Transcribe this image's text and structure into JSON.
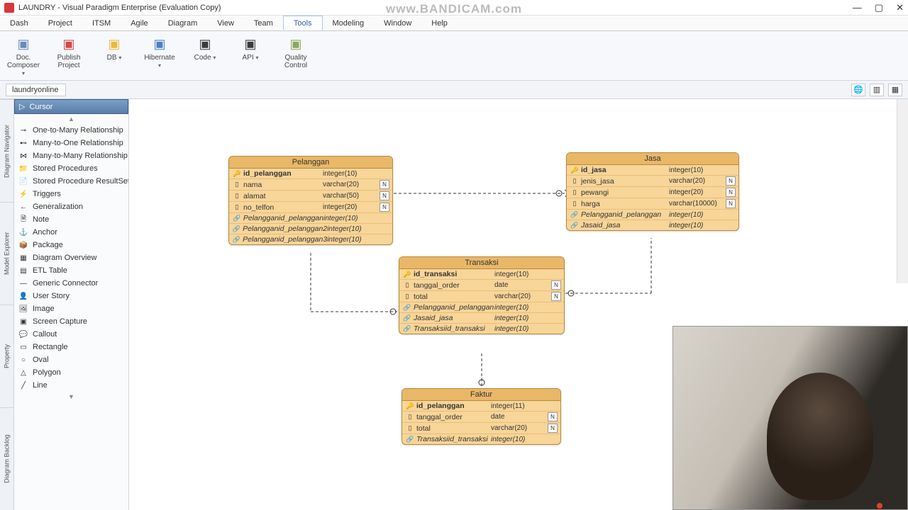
{
  "window": {
    "title": "LAUNDRY - Visual Paradigm Enterprise (Evaluation Copy)",
    "watermark": "www.BANDICAM.com"
  },
  "menu": [
    "Dash",
    "Project",
    "ITSM",
    "Agile",
    "Diagram",
    "View",
    "Team",
    "Tools",
    "Modeling",
    "Window",
    "Help"
  ],
  "menu_active": "Tools",
  "ribbon": [
    {
      "label": "Doc. Composer",
      "dropdown": true,
      "color": "#6a8bb8"
    },
    {
      "label": "Publish Project",
      "dropdown": false,
      "color": "#d24a4a"
    },
    {
      "label": "DB",
      "dropdown": true,
      "color": "#e8b93a"
    },
    {
      "label": "Hibernate",
      "dropdown": true,
      "color": "#4a7fc4"
    },
    {
      "label": "Code",
      "dropdown": true,
      "color": "#3a3a3a"
    },
    {
      "label": "API",
      "dropdown": true,
      "color": "#3a3a3a"
    },
    {
      "label": "Quality Control",
      "dropdown": false,
      "color": "#8aa85a"
    }
  ],
  "breadcrumb": "laundryonline",
  "vertical_tabs": [
    "Diagram Navigator",
    "Model Explorer",
    "Property",
    "Diagram Backlog"
  ],
  "palette_cursor": "Cursor",
  "palette": [
    {
      "icon": "⊸",
      "label": "One-to-Many Relationship"
    },
    {
      "icon": "⊷",
      "label": "Many-to-One Relationship"
    },
    {
      "icon": "⋈",
      "label": "Many-to-Many Relationship"
    },
    {
      "icon": "📁",
      "label": "Stored Procedures"
    },
    {
      "icon": "📄",
      "label": "Stored Procedure ResultSet"
    },
    {
      "icon": "⚡",
      "label": "Triggers"
    },
    {
      "icon": "←",
      "label": "Generalization"
    },
    {
      "icon": "🗎",
      "label": "Note"
    },
    {
      "icon": "⚓",
      "label": "Anchor"
    },
    {
      "icon": "📦",
      "label": "Package"
    },
    {
      "icon": "▦",
      "label": "Diagram Overview"
    },
    {
      "icon": "▤",
      "label": "ETL Table"
    },
    {
      "icon": "—",
      "label": "Generic Connector"
    },
    {
      "icon": "👤",
      "label": "User Story"
    },
    {
      "icon": "🖼",
      "label": "Image"
    },
    {
      "icon": "▣",
      "label": "Screen Capture"
    },
    {
      "icon": "💬",
      "label": "Callout"
    },
    {
      "icon": "▭",
      "label": "Rectangle"
    },
    {
      "icon": "○",
      "label": "Oval"
    },
    {
      "icon": "△",
      "label": "Polygon"
    },
    {
      "icon": "╱",
      "label": "Line"
    }
  ],
  "tables": {
    "pelanggan": {
      "title": "Pelanggan",
      "cols": [
        {
          "icon": "🔑",
          "name": "id_pelanggan",
          "type": "integer(10)",
          "bold": true
        },
        {
          "icon": "▯",
          "name": "nama",
          "type": "varchar(20)",
          "n": true
        },
        {
          "icon": "▯",
          "name": "alamat",
          "type": "varchar(50)",
          "n": true
        },
        {
          "icon": "▯",
          "name": "no_telfon",
          "type": "integer(20)",
          "n": true
        },
        {
          "icon": "🔗",
          "name": "Pelangganid_pelanggan",
          "type": "integer(10)",
          "fk": true
        },
        {
          "icon": "🔗",
          "name": "Pelangganid_pelanggan2",
          "type": "integer(10)",
          "fk": true
        },
        {
          "icon": "🔗",
          "name": "Pelangganid_pelanggan3",
          "type": "integer(10)",
          "fk": true
        }
      ]
    },
    "jasa": {
      "title": "Jasa",
      "cols": [
        {
          "icon": "🔑",
          "name": "id_jasa",
          "type": "integer(10)",
          "bold": true
        },
        {
          "icon": "▯",
          "name": "jenis_jasa",
          "type": "varchar(20)",
          "n": true
        },
        {
          "icon": "▯",
          "name": "pewangi",
          "type": "integer(20)",
          "n": true
        },
        {
          "icon": "▯",
          "name": "harga",
          "type": "varchar(10000)",
          "n": true
        },
        {
          "icon": "🔗",
          "name": "Pelangganid_pelanggan",
          "type": "integer(10)",
          "fk": true
        },
        {
          "icon": "🔗",
          "name": "Jasaid_jasa",
          "type": "integer(10)",
          "fk": true
        }
      ]
    },
    "transaksi": {
      "title": "Transaksi",
      "cols": [
        {
          "icon": "🔑",
          "name": "id_transaksi",
          "type": "integer(10)",
          "bold": true
        },
        {
          "icon": "▯",
          "name": "tanggal_order",
          "type": "date",
          "n": true
        },
        {
          "icon": "▯",
          "name": "total",
          "type": "varchar(20)",
          "n": true
        },
        {
          "icon": "🔗",
          "name": "Pelangganid_pelanggan",
          "type": "integer(10)",
          "fk": true
        },
        {
          "icon": "🔗",
          "name": "Jasaid_jasa",
          "type": "integer(10)",
          "fk": true
        },
        {
          "icon": "🔗",
          "name": "Transaksiid_transaksi",
          "type": "integer(10)",
          "fk": true
        }
      ]
    },
    "faktur": {
      "title": "Faktur",
      "cols": [
        {
          "icon": "🔑",
          "name": "id_pelanggan",
          "type": "integer(11)",
          "bold": true
        },
        {
          "icon": "▯",
          "name": "tanggal_order",
          "type": "date",
          "n": true
        },
        {
          "icon": "▯",
          "name": "total",
          "type": "varchar(20)",
          "n": true
        },
        {
          "icon": "🔗",
          "name": "Transaksiid_transaksi",
          "type": "integer(10)",
          "fk": true
        }
      ]
    }
  }
}
